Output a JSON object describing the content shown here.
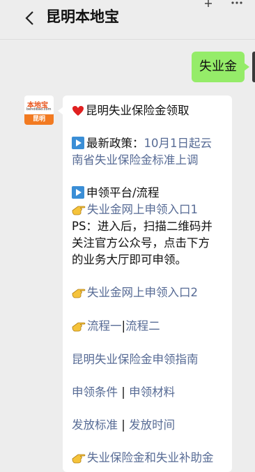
{
  "header": {
    "title": "昆明本地宝"
  },
  "user_message": {
    "text": "失业金"
  },
  "bot_avatar": {
    "logo": "本地宝",
    "site": "bendibao.com",
    "city": "昆明"
  },
  "reply": {
    "line1": "昆明失业保险金领取",
    "policy_prefix": "最新政策：",
    "policy_link_1": "10月1日起云",
    "policy_link_2": "南省失业保险金标准上调",
    "platform_heading": "申领平台/流程",
    "entry1": "失业金网上申领入口1",
    "ps_1": "PS：进入后，扫描二维码并",
    "ps_2": "关注官方公众号，点击下方",
    "ps_3": "的业务大厅即可申领。",
    "entry2": "失业金网上申领入口2",
    "process1": "流程一",
    "process_sep": "|",
    "process2": "流程二",
    "guide": "昆明失业保险金申领指南",
    "conditions": "申领条件",
    "sep1": " | ",
    "materials": "申领材料",
    "standard": "发放标准",
    "sep2": " | ",
    "time": "发放时间",
    "subsidy": "失业保险金和失业补助金"
  },
  "colors": {
    "link": "#576b95",
    "my_bubble": "#95ec69",
    "avatar_orange": "#f27a21"
  },
  "icons": [
    "back-chevron-icon",
    "pin-icon",
    "more-icon",
    "heart-icon",
    "play-button-icon",
    "pointing-hand-icon"
  ]
}
